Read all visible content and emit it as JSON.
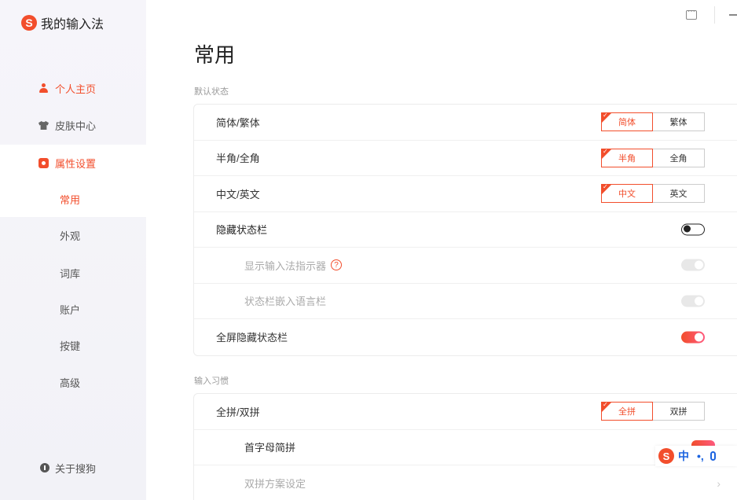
{
  "app": {
    "name": "我的输入法"
  },
  "sidebar": {
    "top_items": [
      {
        "label": "个人主页",
        "icon": "person-icon"
      },
      {
        "label": "皮肤中心",
        "icon": "shirt-icon"
      },
      {
        "label": "属性设置",
        "icon": "gear-icon"
      }
    ],
    "sub_items": [
      "常用",
      "外观",
      "词库",
      "账户",
      "按键",
      "高级"
    ],
    "about": {
      "label": "关于搜狗",
      "icon": "info-icon"
    }
  },
  "main": {
    "title": "常用",
    "sections": [
      {
        "label": "默认状态"
      },
      {
        "label": "输入习惯"
      }
    ],
    "default_state": {
      "jianfan": {
        "label": "简体/繁体",
        "options": [
          "简体",
          "繁体"
        ],
        "selected": "简体"
      },
      "banquan": {
        "label": "半角/全角",
        "options": [
          "半角",
          "全角"
        ],
        "selected": "半角"
      },
      "zhongying": {
        "label": "中文/英文",
        "options": [
          "中文",
          "英文"
        ],
        "selected": "中文"
      },
      "hide_status": {
        "label": "隐藏状态栏",
        "state": "off"
      },
      "show_indicator": {
        "label": "显示输入法指示器",
        "state": "disabled"
      },
      "embed_lang": {
        "label": "状态栏嵌入语言栏",
        "state": "disabled"
      },
      "fullscreen_hide": {
        "label": "全屏隐藏状态栏",
        "state": "on"
      }
    },
    "input_habit": {
      "quanshuang": {
        "label": "全拼/双拼",
        "options": [
          "全拼",
          "双拼"
        ],
        "selected": "全拼"
      },
      "shouzimu": {
        "label": "首字母简拼"
      },
      "shuangpin_scheme": {
        "label": "双拼方案设定"
      }
    }
  },
  "ime_bar": {
    "lang": "中",
    "punct": "•,"
  },
  "colors": {
    "accent": "#f24e2c",
    "ime_blue": "#1c64e0"
  }
}
